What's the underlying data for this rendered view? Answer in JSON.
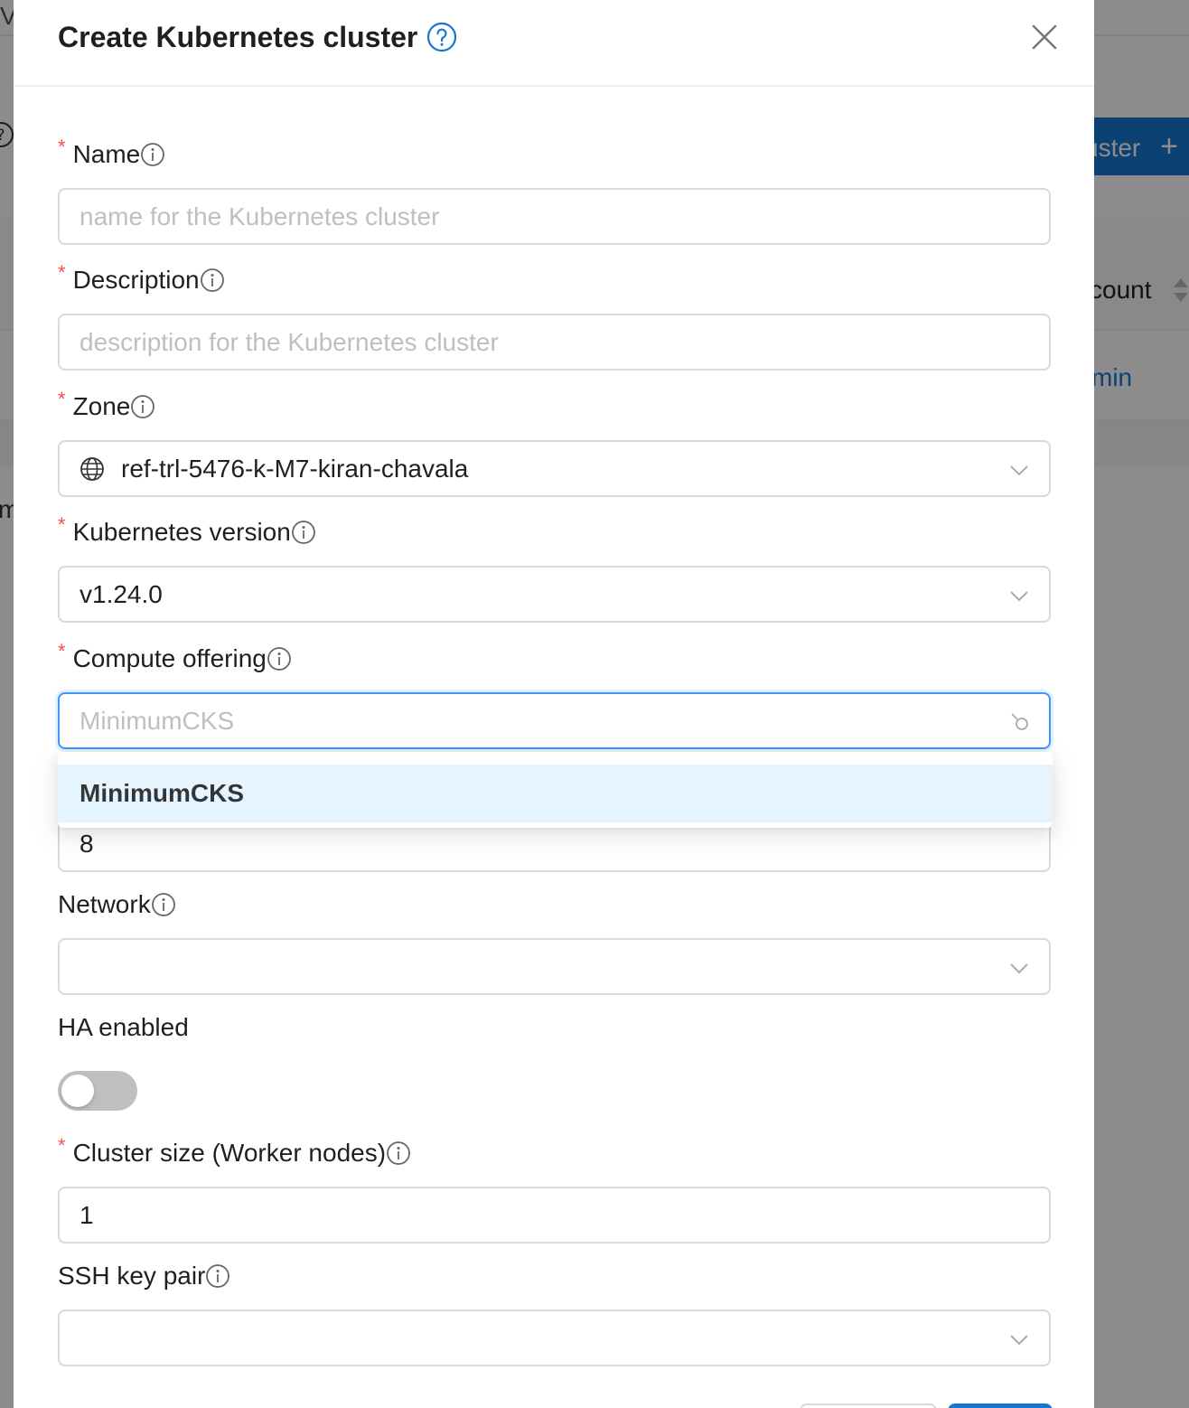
{
  "background": {
    "button_label": "uster",
    "plus_symbol": "+",
    "col_header": "count",
    "row_link": "min",
    "left_edge_char": "m",
    "top_edge_char": "V"
  },
  "modal": {
    "title": "Create Kubernetes cluster",
    "fields": {
      "name": {
        "label": "Name",
        "placeholder": "name for the Kubernetes cluster"
      },
      "description": {
        "label": "Description",
        "placeholder": "description for the Kubernetes cluster"
      },
      "zone": {
        "label": "Zone",
        "value": "ref-trl-5476-k-M7-kiran-chavala"
      },
      "version": {
        "label": "Kubernetes version",
        "value": "v1.24.0"
      },
      "compute_offering": {
        "label": "Compute offering",
        "placeholder": "MinimumCKS"
      },
      "hidden_field": {
        "value": "8"
      },
      "network": {
        "label": "Network",
        "value": ""
      },
      "ha": {
        "label": "HA enabled",
        "checked": false
      },
      "cluster_size": {
        "label": "Cluster size (Worker nodes)",
        "value": "1"
      },
      "ssh_key": {
        "label": "SSH key pair",
        "value": ""
      }
    },
    "dropdown_options": [
      "MinimumCKS"
    ]
  },
  "colors": {
    "primary": "#1677d2",
    "required": "#ff4d4f",
    "focus_border": "#4096ff",
    "option_highlight": "#e6f4ff"
  }
}
